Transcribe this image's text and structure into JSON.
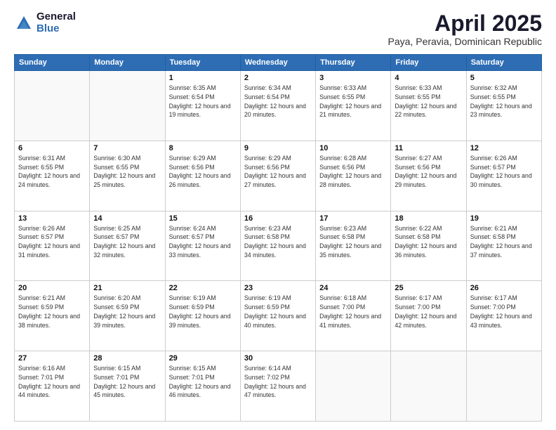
{
  "logo": {
    "general": "General",
    "blue": "Blue"
  },
  "title": "April 2025",
  "subtitle": "Paya, Peravia, Dominican Republic",
  "days_of_week": [
    "Sunday",
    "Monday",
    "Tuesday",
    "Wednesday",
    "Thursday",
    "Friday",
    "Saturday"
  ],
  "weeks": [
    [
      {
        "day": "",
        "info": ""
      },
      {
        "day": "",
        "info": ""
      },
      {
        "day": "1",
        "info": "Sunrise: 6:35 AM\nSunset: 6:54 PM\nDaylight: 12 hours and 19 minutes."
      },
      {
        "day": "2",
        "info": "Sunrise: 6:34 AM\nSunset: 6:54 PM\nDaylight: 12 hours and 20 minutes."
      },
      {
        "day": "3",
        "info": "Sunrise: 6:33 AM\nSunset: 6:55 PM\nDaylight: 12 hours and 21 minutes."
      },
      {
        "day": "4",
        "info": "Sunrise: 6:33 AM\nSunset: 6:55 PM\nDaylight: 12 hours and 22 minutes."
      },
      {
        "day": "5",
        "info": "Sunrise: 6:32 AM\nSunset: 6:55 PM\nDaylight: 12 hours and 23 minutes."
      }
    ],
    [
      {
        "day": "6",
        "info": "Sunrise: 6:31 AM\nSunset: 6:55 PM\nDaylight: 12 hours and 24 minutes."
      },
      {
        "day": "7",
        "info": "Sunrise: 6:30 AM\nSunset: 6:55 PM\nDaylight: 12 hours and 25 minutes."
      },
      {
        "day": "8",
        "info": "Sunrise: 6:29 AM\nSunset: 6:56 PM\nDaylight: 12 hours and 26 minutes."
      },
      {
        "day": "9",
        "info": "Sunrise: 6:29 AM\nSunset: 6:56 PM\nDaylight: 12 hours and 27 minutes."
      },
      {
        "day": "10",
        "info": "Sunrise: 6:28 AM\nSunset: 6:56 PM\nDaylight: 12 hours and 28 minutes."
      },
      {
        "day": "11",
        "info": "Sunrise: 6:27 AM\nSunset: 6:56 PM\nDaylight: 12 hours and 29 minutes."
      },
      {
        "day": "12",
        "info": "Sunrise: 6:26 AM\nSunset: 6:57 PM\nDaylight: 12 hours and 30 minutes."
      }
    ],
    [
      {
        "day": "13",
        "info": "Sunrise: 6:26 AM\nSunset: 6:57 PM\nDaylight: 12 hours and 31 minutes."
      },
      {
        "day": "14",
        "info": "Sunrise: 6:25 AM\nSunset: 6:57 PM\nDaylight: 12 hours and 32 minutes."
      },
      {
        "day": "15",
        "info": "Sunrise: 6:24 AM\nSunset: 6:57 PM\nDaylight: 12 hours and 33 minutes."
      },
      {
        "day": "16",
        "info": "Sunrise: 6:23 AM\nSunset: 6:58 PM\nDaylight: 12 hours and 34 minutes."
      },
      {
        "day": "17",
        "info": "Sunrise: 6:23 AM\nSunset: 6:58 PM\nDaylight: 12 hours and 35 minutes."
      },
      {
        "day": "18",
        "info": "Sunrise: 6:22 AM\nSunset: 6:58 PM\nDaylight: 12 hours and 36 minutes."
      },
      {
        "day": "19",
        "info": "Sunrise: 6:21 AM\nSunset: 6:58 PM\nDaylight: 12 hours and 37 minutes."
      }
    ],
    [
      {
        "day": "20",
        "info": "Sunrise: 6:21 AM\nSunset: 6:59 PM\nDaylight: 12 hours and 38 minutes."
      },
      {
        "day": "21",
        "info": "Sunrise: 6:20 AM\nSunset: 6:59 PM\nDaylight: 12 hours and 39 minutes."
      },
      {
        "day": "22",
        "info": "Sunrise: 6:19 AM\nSunset: 6:59 PM\nDaylight: 12 hours and 39 minutes."
      },
      {
        "day": "23",
        "info": "Sunrise: 6:19 AM\nSunset: 6:59 PM\nDaylight: 12 hours and 40 minutes."
      },
      {
        "day": "24",
        "info": "Sunrise: 6:18 AM\nSunset: 7:00 PM\nDaylight: 12 hours and 41 minutes."
      },
      {
        "day": "25",
        "info": "Sunrise: 6:17 AM\nSunset: 7:00 PM\nDaylight: 12 hours and 42 minutes."
      },
      {
        "day": "26",
        "info": "Sunrise: 6:17 AM\nSunset: 7:00 PM\nDaylight: 12 hours and 43 minutes."
      }
    ],
    [
      {
        "day": "27",
        "info": "Sunrise: 6:16 AM\nSunset: 7:01 PM\nDaylight: 12 hours and 44 minutes."
      },
      {
        "day": "28",
        "info": "Sunrise: 6:15 AM\nSunset: 7:01 PM\nDaylight: 12 hours and 45 minutes."
      },
      {
        "day": "29",
        "info": "Sunrise: 6:15 AM\nSunset: 7:01 PM\nDaylight: 12 hours and 46 minutes."
      },
      {
        "day": "30",
        "info": "Sunrise: 6:14 AM\nSunset: 7:02 PM\nDaylight: 12 hours and 47 minutes."
      },
      {
        "day": "",
        "info": ""
      },
      {
        "day": "",
        "info": ""
      },
      {
        "day": "",
        "info": ""
      }
    ]
  ]
}
